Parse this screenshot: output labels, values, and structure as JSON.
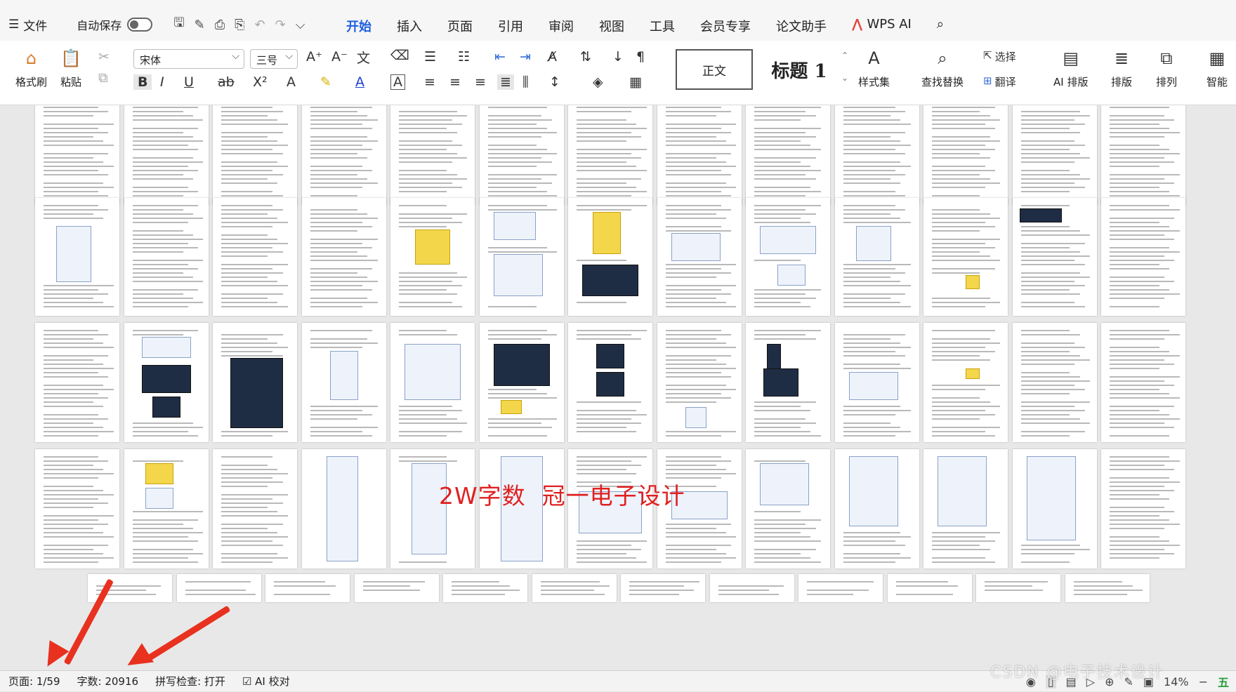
{
  "menu": {
    "file_label": "文件",
    "autosave_label": "自动保存"
  },
  "tabs": [
    {
      "label": "开始",
      "active": true
    },
    {
      "label": "插入"
    },
    {
      "label": "页面"
    },
    {
      "label": "引用"
    },
    {
      "label": "审阅"
    },
    {
      "label": "视图"
    },
    {
      "label": "工具"
    },
    {
      "label": "会员专享"
    },
    {
      "label": "论文助手"
    },
    {
      "label": "WPS AI"
    }
  ],
  "ribbon": {
    "format_painter": "格式刷",
    "paste": "粘贴",
    "font_name": "宋体",
    "font_size": "三号",
    "style_normal": "正文",
    "style_heading1": "标题 1",
    "style_set": "样式集",
    "find_replace": "查找替换",
    "select": "选择",
    "translate": "翻译",
    "ai_layout": "AI 排版",
    "layout": "排版",
    "arrange": "排列",
    "smart": "智能"
  },
  "document": {
    "watermark_text": "2W字数  冠一电子设计"
  },
  "status": {
    "page": "页面: 1/59",
    "word_count": "字数: 20916",
    "spell_check": "拼写检查: 打开",
    "ai_proof": "AI 校对",
    "zoom": "14%",
    "csdn_mark": "CSDN @电子技术设计"
  },
  "colors": {
    "accent": "#1f5fe0",
    "annotation_red": "#e02020"
  }
}
